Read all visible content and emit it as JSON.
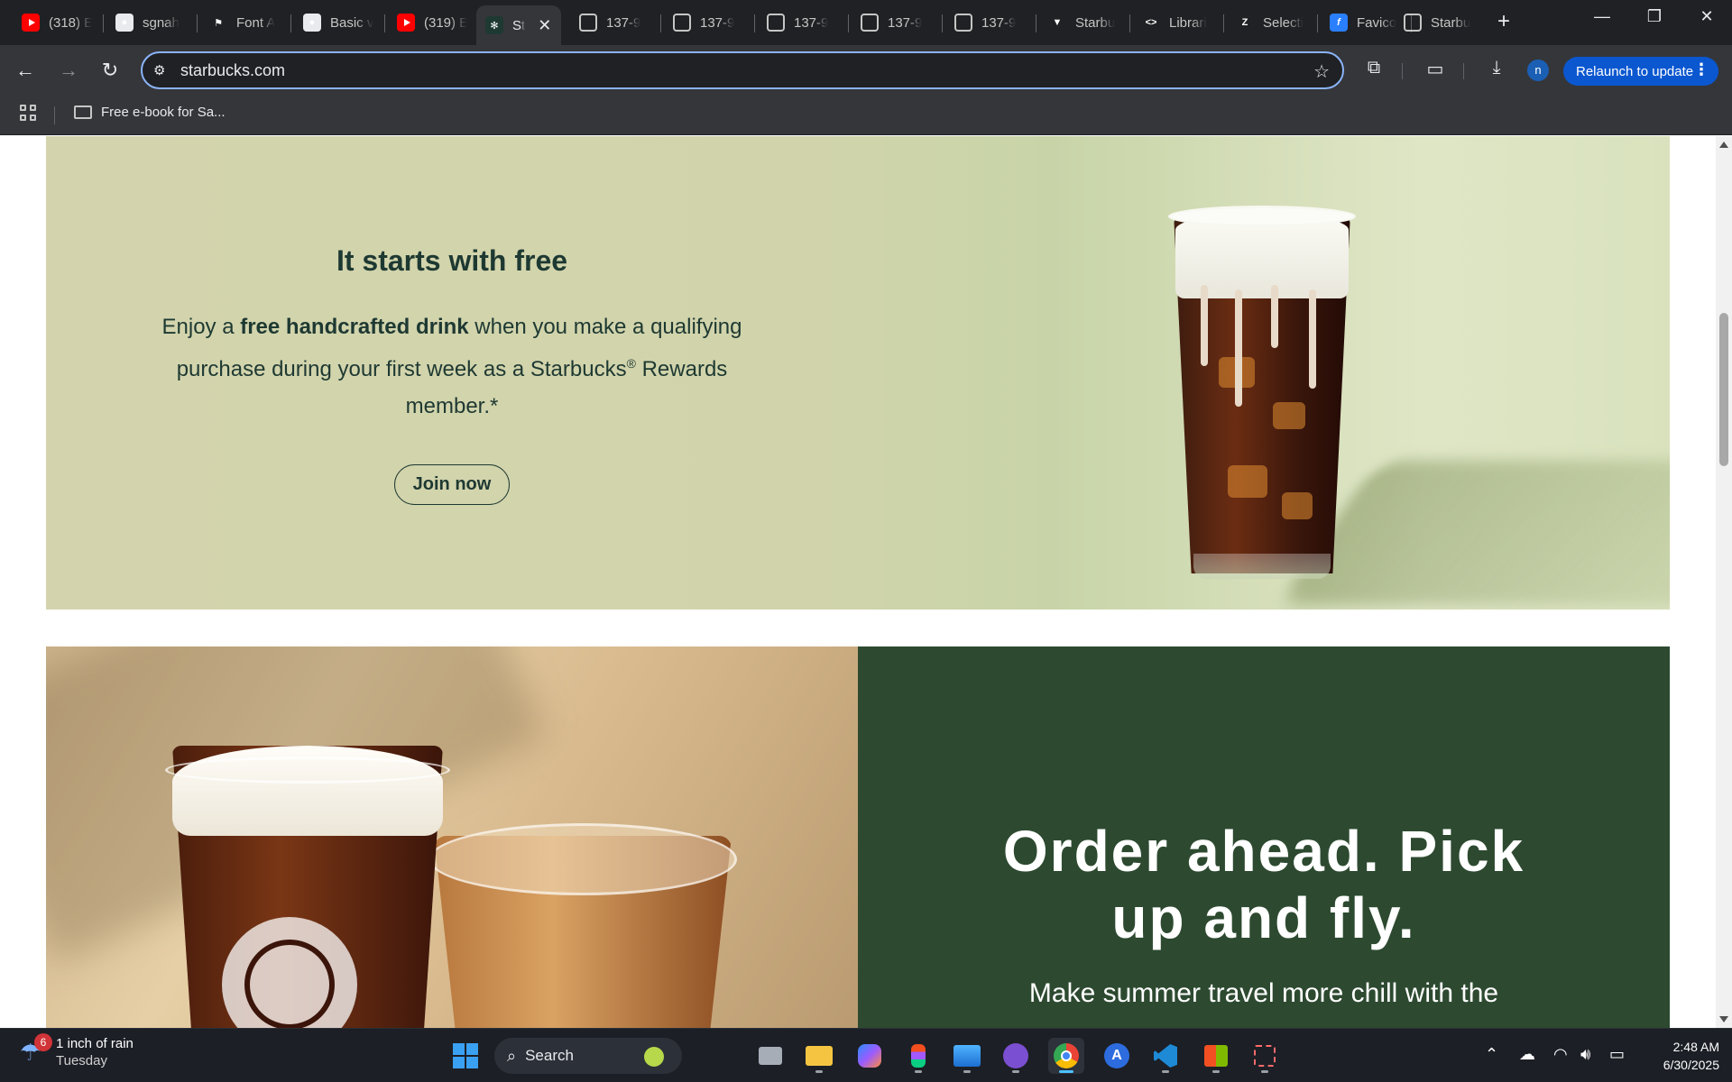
{
  "browser": {
    "tabs": [
      {
        "title": "(318) E",
        "icon": "youtube-icon",
        "active": false
      },
      {
        "title": "sgnah",
        "icon": "github-icon",
        "active": false
      },
      {
        "title": "Font A",
        "icon": "flag-icon",
        "active": false
      },
      {
        "title": "Basic v",
        "icon": "github-icon",
        "active": false
      },
      {
        "title": "(319) E",
        "icon": "youtube-icon",
        "active": false
      },
      {
        "title": "St",
        "icon": "starbucks-icon",
        "active": true
      },
      {
        "title": "137-9",
        "icon": "globe-icon",
        "active": false
      },
      {
        "title": "137-9",
        "icon": "globe-icon",
        "active": false
      },
      {
        "title": "137-9",
        "icon": "globe-icon",
        "active": false
      },
      {
        "title": "137-9",
        "icon": "globe-icon",
        "active": false
      },
      {
        "title": "137-9",
        "icon": "globe-icon",
        "active": false
      },
      {
        "title": "Starbu",
        "icon": "vuetify-icon",
        "active": false
      },
      {
        "title": "Librari",
        "icon": "code-icon",
        "active": false
      },
      {
        "title": "Selecti",
        "icon": "zoho-icon",
        "active": false
      },
      {
        "title": "Favico",
        "icon": "favicon-icon",
        "active": false
      },
      {
        "title": "Starbu",
        "icon": "globe-icon",
        "active": false
      }
    ],
    "url": "starbucks.com",
    "relaunch_label": "Relaunch to update",
    "profile_initial": "n",
    "bookmarks": [
      {
        "label": "Free e-book for Sa...",
        "icon": "folder-icon"
      }
    ]
  },
  "page": {
    "rewards": {
      "heading": "It starts with free",
      "body_pre": "Enjoy a ",
      "body_bold": "free handcrafted drink",
      "body_post": " when you make a qualifying purchase during your first week as a Starbucks",
      "body_reg": "®",
      "body_end": " Rewards member.*",
      "cta": "Join now"
    },
    "order": {
      "heading": "Order ahead. Pick up and fly.",
      "body": "Make summer travel more chill with the"
    },
    "colors": {
      "brand_green": "#1e3932",
      "order_panel": "#2d4a30",
      "rewards_bg": "#d3d4ad"
    }
  },
  "taskbar": {
    "weather_badge": "6",
    "weather_line1": "1 inch of rain",
    "weather_line2": "Tuesday",
    "search_label": "Search",
    "time": "2:48 AM",
    "date": "6/30/2025"
  }
}
